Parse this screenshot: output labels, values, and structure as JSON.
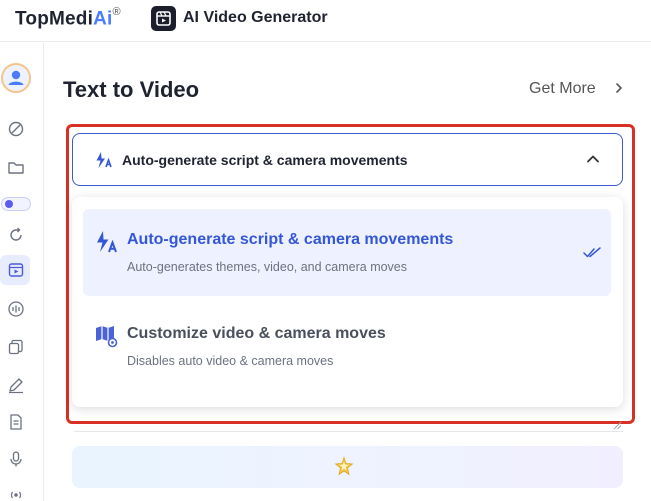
{
  "header": {
    "brand_main": "TopMedi",
    "brand_ai": "Ai",
    "brand_reg": "®",
    "app_title": "AI Video Generator",
    "app_icon": "film-play-icon"
  },
  "sidebar": {
    "icons": [
      "avatar",
      "magic-wand-icon",
      "folder-icon",
      "toggle",
      "refresh-icon",
      "video-play-icon",
      "audio-wave-icon",
      "copy-icon",
      "pen-icon",
      "document-icon",
      "microphone-icon",
      "broadcast-icon"
    ],
    "active_item": "video-play-icon"
  },
  "main": {
    "title": "Text to Video",
    "get_more": "Get More"
  },
  "mode_select": {
    "current_label": "Auto-generate script & camera movements",
    "expanded": true,
    "options": [
      {
        "label": "Auto-generate script & camera movements",
        "description": "Auto-generates themes, video, and camera moves",
        "selected": true,
        "icon": "auto-script-icon"
      },
      {
        "label": "Customize video & camera moves",
        "description": "Disables auto video & camera moves",
        "selected": false,
        "icon": "customize-map-icon"
      }
    ]
  },
  "colors": {
    "accent": "#3457d5",
    "highlight_frame": "#d93025",
    "selected_bg": "#eef1ff"
  }
}
